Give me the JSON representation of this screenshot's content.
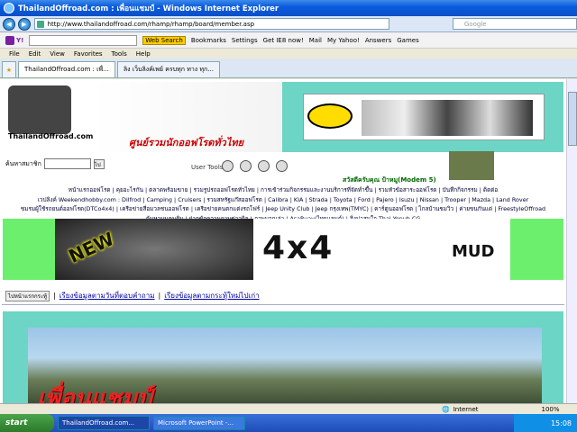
{
  "window": {
    "title": "ThailandOffroad.com : เพื่อนแชมป์ - Windows Internet Explorer"
  },
  "address": {
    "url": "http://www.thailandoffroad.com/rhamp/rhamp/board/member.asp",
    "search_placeholder": "Google"
  },
  "toolbar": {
    "search_btn": "Web Search",
    "items": [
      "Bookmarks",
      "Settings",
      "Get IE8 now!",
      "Mail",
      "My Yahoo!",
      "Answers",
      "Games"
    ]
  },
  "menu": [
    "File",
    "Edit",
    "View",
    "Favorites",
    "Tools",
    "Help"
  ],
  "tabs": [
    "ThailandOffroad.com : เพื่...",
    "ลิง เว็บลิงค์เพย์ ครบทุก ทาง ทุก..."
  ],
  "page": {
    "search_label": "ค้นหาสมาชิก",
    "search_go": "ไป",
    "user_tools": "User Tools",
    "welcome": "สวัสดีครับคุณ ป้าหมู(Modem 5)",
    "logo_text": "ThailandOffroad.com",
    "logo_slogan": "ศูนย์รวมนักออฟโรดทั่วไทย",
    "banner_new": "NEW",
    "banner_4x4": "4x4",
    "banner_mud": "MUD",
    "page_btn": "ไปหน้าแรกกระทู้",
    "link1": "เรียงข้อมูลตามวันที่ตอบคำถาม",
    "link2": "เรียงข้อมูลตามกระทู้ใหม่ไปเก่า",
    "photo_title": "เพื่อนแชมป์"
  },
  "links_lines": [
    "หน้าแรกออฟโรด | คุยอะไรกัน | ตลาดพร้อมขาย | รวมรูปรถออฟโรดทั่วไทย | การเข้าร่วมกิจกรรมและงานบริการที่จัดทำขึ้น | รวมหัวข้อสาระออฟโรด | บันทึกกิจกรรม | ติดต่อ",
    "เวปลิงค์ Weekendhobby.com : Dilfrod | Camping | Cruisers | รวมสหรัฐแก๊สออฟโรด | Calibra | KIA | Strada | Toyota | Ford | Pajero | Isuzu | Nissan | Trooper | Mazda | Land Rover",
    "ชมรมผู้ใช้รถยนต์ออฟโรด(DTCo4x4) | เครือข่ายสื่อมวลชนออฟโรด | เครือข่ายคนตกแต่งรถโฟร์ | Jeep Unity Club | Jeep กรุงเทพ(TMYC) | คาร์ตูนออฟโรด | ไกลบ้านชมวิว | ค่ายขนกันแด่ | FreestyleOffroad",
    "ค้นหาบนคนดิบ | ฝากข้อความถามข่าวกิจ | ภาพบอกเล่า | AsaRuay(ไทยแลนด์) | สิ่งน่าสนใจ Thai Yopub.CG"
  ],
  "status": {
    "zone": "Internet",
    "zoom": "100%"
  },
  "taskbar": {
    "start": "start",
    "tasks": [
      "ThailandOffroad.com...",
      "Microsoft PowerPoint -..."
    ],
    "clock": "15:08"
  },
  "colors": {
    "accent": "#6cd5c5",
    "banner_bg": "#6cef6c",
    "title_red": "#e22222"
  }
}
